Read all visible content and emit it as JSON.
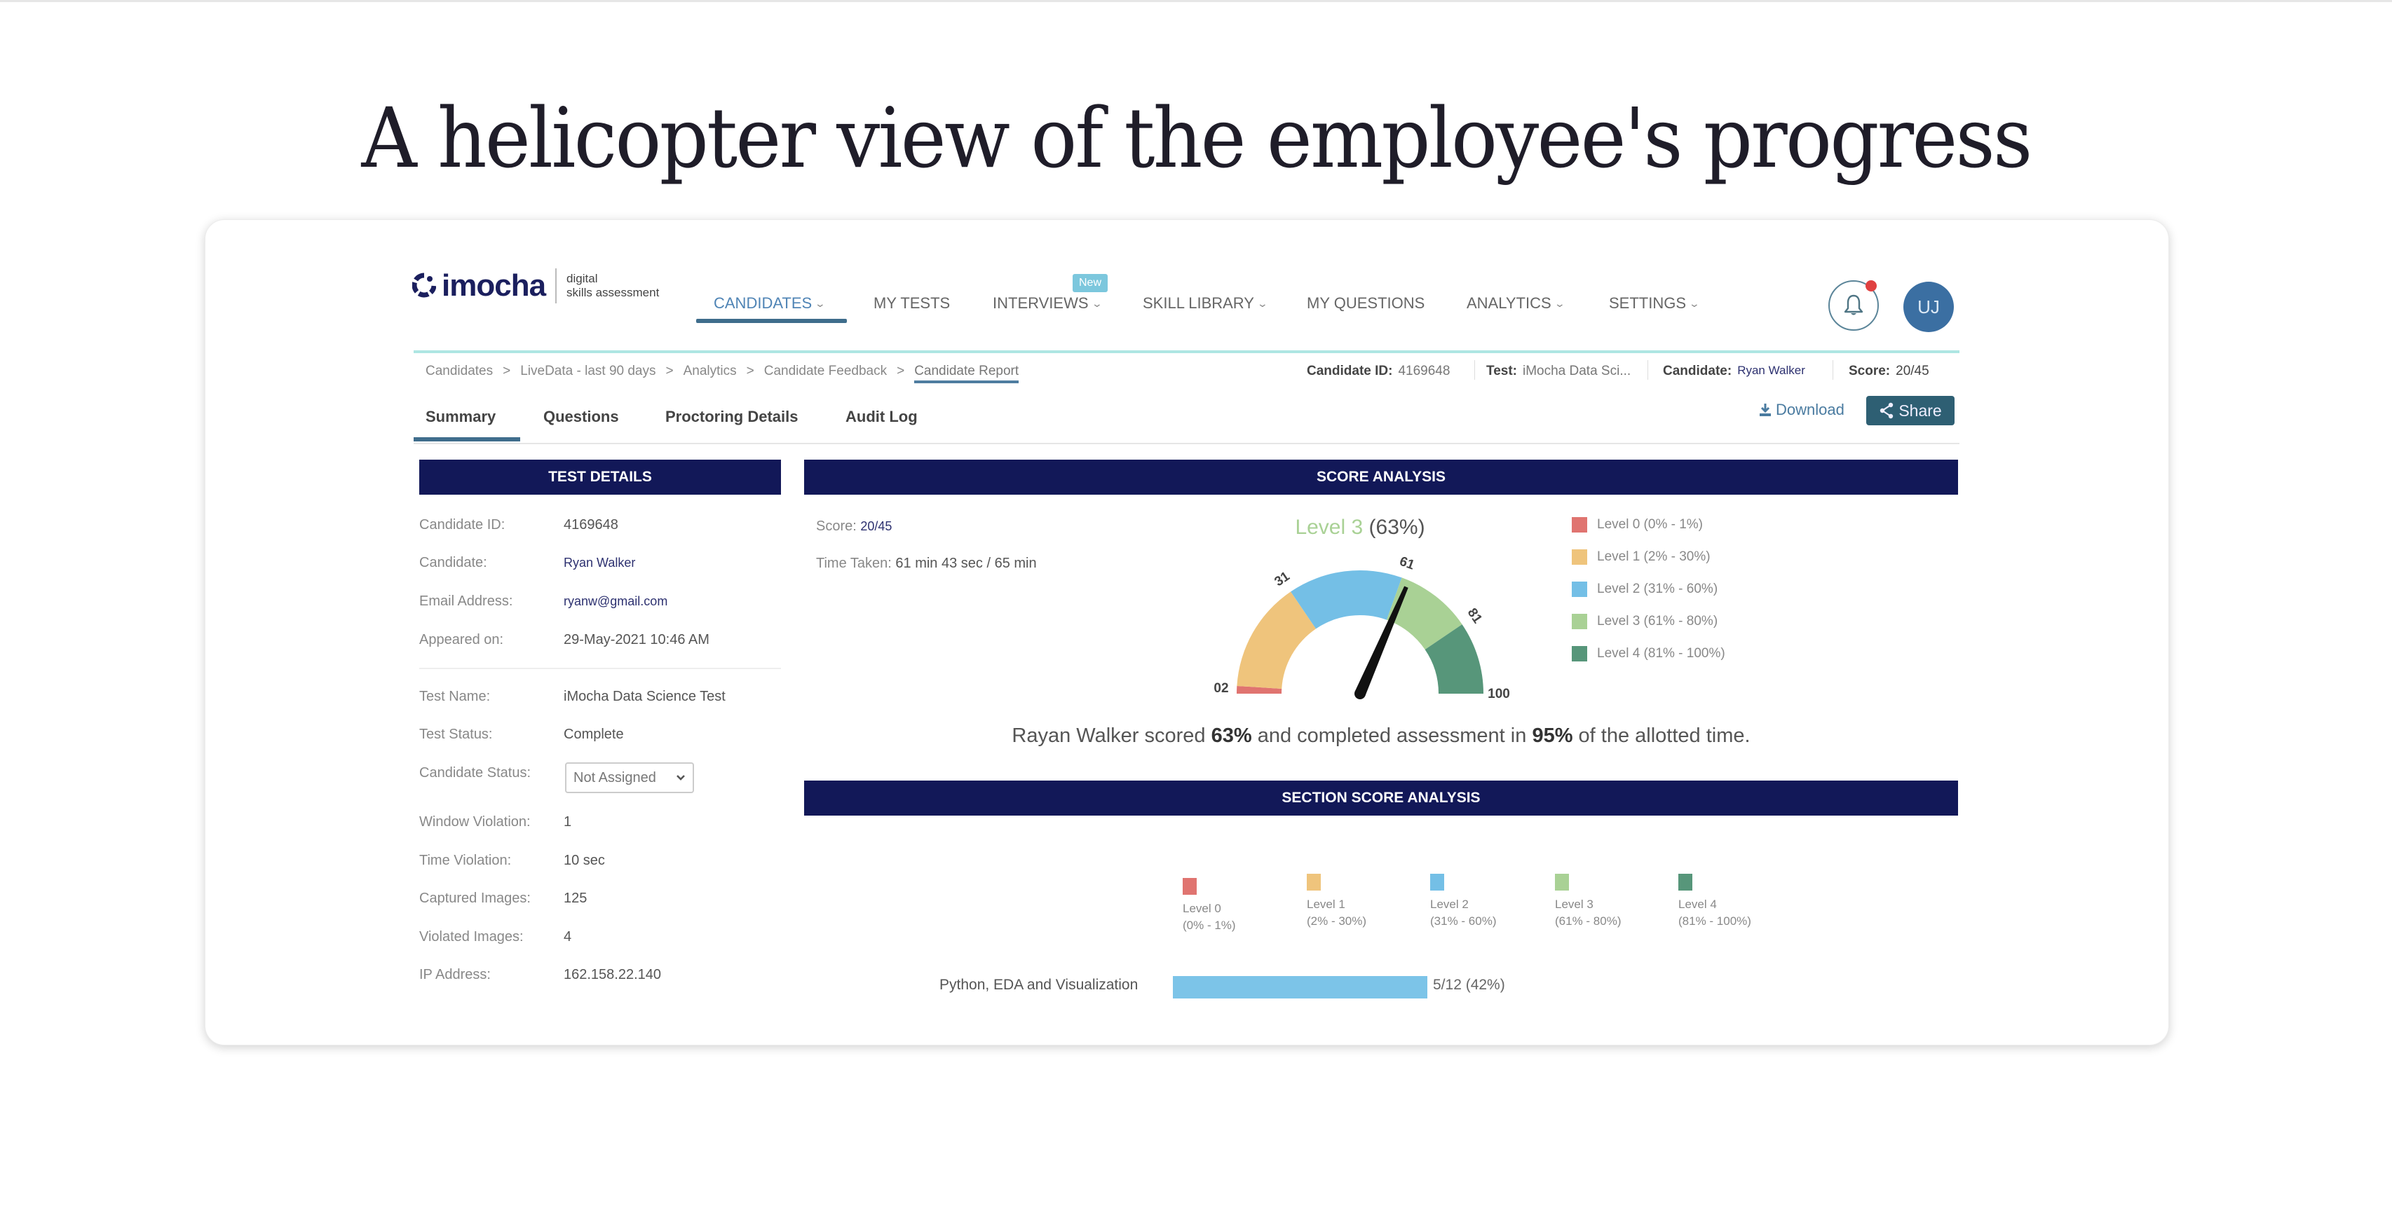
{
  "headline": "A helicopter view of the employee's progress",
  "brand": {
    "name": "imocha",
    "tagline_line1": "digital",
    "tagline_line2": "skills assessment",
    "color": "#1b1f5e"
  },
  "nav": {
    "items": [
      {
        "label": "CANDIDATES",
        "dropdown": true,
        "active": true
      },
      {
        "label": "MY TESTS",
        "dropdown": false
      },
      {
        "label": "INTERVIEWS",
        "dropdown": true,
        "badge": "New"
      },
      {
        "label": "SKILL LIBRARY",
        "dropdown": true
      },
      {
        "label": "MY QUESTIONS",
        "dropdown": false
      },
      {
        "label": "ANALYTICS",
        "dropdown": true
      },
      {
        "label": "SETTINGS",
        "dropdown": true
      }
    ],
    "chevron": "⌄",
    "notification_icon": "bell-icon",
    "has_notification": true,
    "avatar_initials": "UJ"
  },
  "breadcrumb": {
    "items": [
      "Candidates",
      "LiveData - last 90 days",
      "Analytics",
      "Candidate Feedback",
      "Candidate Report"
    ],
    "separator": ">"
  },
  "candidate_meta": {
    "id_label": "Candidate ID:",
    "id_value": "4169648",
    "test_label": "Test:",
    "test_value": "iMocha Data Sci...",
    "candidate_label": "Candidate:",
    "candidate_value": "Ryan Walker",
    "score_label": "Score:",
    "score_value": "20/45"
  },
  "tabs": [
    {
      "label": "Summary",
      "active": true
    },
    {
      "label": "Questions"
    },
    {
      "label": "Proctoring Details"
    },
    {
      "label": "Audit Log"
    }
  ],
  "actions": {
    "download_label": "Download",
    "share_label": "Share"
  },
  "test_details": {
    "title": "TEST DETAILS",
    "rows": [
      {
        "label": "Candidate ID:",
        "value": "4169648"
      },
      {
        "label": "Candidate:",
        "value": "Ryan Walker"
      },
      {
        "label": "Email Address:",
        "value": "ryanw@gmail.com"
      },
      {
        "label": "Appeared on:",
        "value": "29-May-2021 10:46 AM"
      },
      {
        "label": "Test Name:",
        "value": "iMocha Data Science Test"
      },
      {
        "label": "Test Status:",
        "value": "Complete"
      },
      {
        "label": "Candidate Status:",
        "value": "Not Assigned"
      },
      {
        "label": "Window Violation:",
        "value": "1"
      },
      {
        "label": "Time Violation:",
        "value": "10 sec"
      },
      {
        "label": "Captured Images:",
        "value": "125"
      },
      {
        "label": "Violated Images:",
        "value": "4"
      },
      {
        "label": "IP Address:",
        "value": "162.158.22.140"
      }
    ]
  },
  "score_analysis": {
    "title": "SCORE ANALYSIS",
    "score_label": "Score:",
    "score_value": "20/45",
    "time_label": "Time Taken:",
    "time_value": "61 min 43 sec / 65 min",
    "gauge": {
      "level_label": "Level 3",
      "percent_label": "(63%)",
      "value": 63,
      "min": 0,
      "max": 100,
      "tick_labels": [
        {
          "value": 2,
          "label": "02"
        },
        {
          "value": 31,
          "label": "31"
        },
        {
          "value": 61,
          "label": "61"
        },
        {
          "value": 81,
          "label": "81"
        },
        {
          "value": 100,
          "label": "100"
        }
      ],
      "bands": [
        {
          "from": 0,
          "to": 2,
          "color": "#e07470"
        },
        {
          "from": 2,
          "to": 31,
          "color": "#efc47c"
        },
        {
          "from": 31,
          "to": 61,
          "color": "#74bfe6"
        },
        {
          "from": 61,
          "to": 81,
          "color": "#a9d195"
        },
        {
          "from": 81,
          "to": 100,
          "color": "#57967a"
        }
      ]
    },
    "legend": [
      {
        "label": "Level 0 (0% - 1%)",
        "color": "#e07470"
      },
      {
        "label": "Level 1 (2% - 30%)",
        "color": "#efc47c"
      },
      {
        "label": "Level 2 (31% - 60%)",
        "color": "#74bfe6"
      },
      {
        "label": "Level 3 (61% - 80%)",
        "color": "#a9d195"
      },
      {
        "label": "Level 4 (81% - 100%)",
        "color": "#57967a"
      }
    ],
    "summary": {
      "prefix": "Rayan Walker scored ",
      "score": "63%",
      "middle": " and completed assessment in ",
      "time": "95%",
      "suffix": " of the allotted time."
    }
  },
  "section_score": {
    "title": "SECTION SCORE ANALYSIS",
    "legend": [
      {
        "name": "Level 0",
        "range": "(0% - 1%)",
        "color": "#e07470"
      },
      {
        "name": "Level 1",
        "range": "(2% - 30%)",
        "color": "#efc47c"
      },
      {
        "name": "Level 2",
        "range": "(31% - 60%)",
        "color": "#74bfe6"
      },
      {
        "name": "Level 3",
        "range": "(61% - 80%)",
        "color": "#a9d195"
      },
      {
        "name": "Level 4",
        "range": "(81% - 100%)",
        "color": "#57967a"
      }
    ],
    "sections": [
      {
        "name": "Python, EDA and Visualization",
        "score_label": "5/12 (42%)",
        "percent": 42,
        "color": "#7cc4e8"
      }
    ]
  },
  "chart_data": [
    {
      "type": "gauge",
      "title": "Level 3 (63%)",
      "value": 63,
      "range": [
        0,
        100
      ],
      "bands": [
        {
          "label": "Level 0",
          "from": 0,
          "to": 2
        },
        {
          "label": "Level 1",
          "from": 2,
          "to": 31
        },
        {
          "label": "Level 2",
          "from": 31,
          "to": 61
        },
        {
          "label": "Level 3",
          "from": 61,
          "to": 81
        },
        {
          "label": "Level 4",
          "from": 81,
          "to": 100
        }
      ],
      "tick_labels": [
        "02",
        "31",
        "61",
        "81",
        "100"
      ],
      "legend": [
        "Level 0 (0% - 1%)",
        "Level 1 (2% - 30%)",
        "Level 2 (31% - 60%)",
        "Level 3 (61% - 80%)",
        "Level 4 (81% - 100%)"
      ],
      "legend_position": "right"
    },
    {
      "type": "bar",
      "title": "SECTION SCORE ANALYSIS",
      "orientation": "horizontal",
      "categories": [
        "Python, EDA and Visualization"
      ],
      "values": [
        42
      ],
      "data_labels": [
        "5/12 (42%)"
      ],
      "xlim": [
        0,
        100
      ],
      "legend": [
        "Level 0 (0% - 1%)",
        "Level 1 (2% - 30%)",
        "Level 2 (31% - 60%)",
        "Level 3 (61% - 80%)",
        "Level 4 (81% - 100%)"
      ],
      "legend_position": "top"
    }
  ]
}
